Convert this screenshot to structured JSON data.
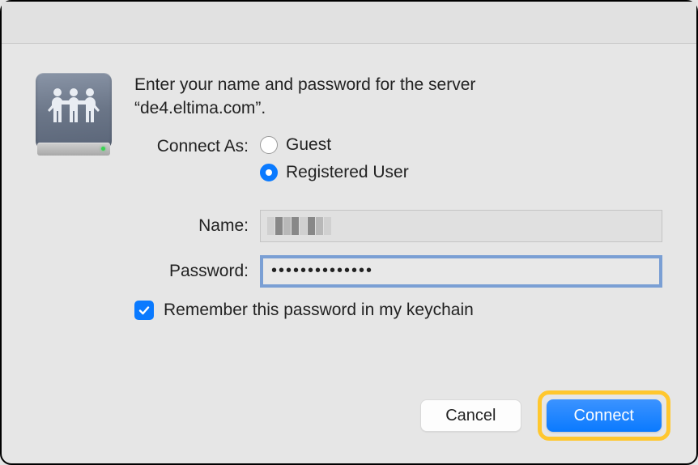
{
  "dialog": {
    "prompt_line1": "Enter your name and password for the server",
    "prompt_line2": "“de4.eltima.com”.",
    "connect_as_label": "Connect As:",
    "radio_guest": "Guest",
    "radio_registered": "Registered User",
    "name_label": "Name:",
    "name_value": "",
    "password_label": "Password:",
    "password_value": "••••••••••••••",
    "remember_label": "Remember this password in my keychain",
    "cancel_label": "Cancel",
    "connect_label": "Connect",
    "selected_radio": "registered",
    "remember_checked": true
  }
}
